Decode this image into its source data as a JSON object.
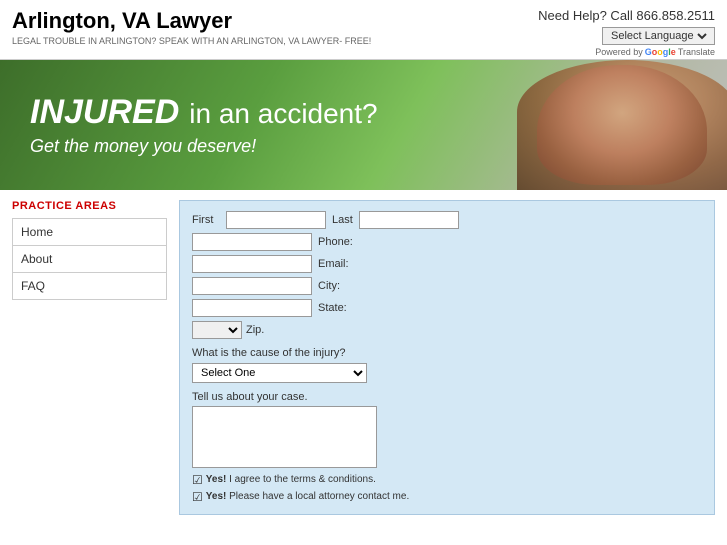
{
  "header": {
    "title": "Arlington, VA Lawyer",
    "subtitle": "LEGAL TROUBLE IN ARLINGTON? SPEAK WITH AN ARLINGTON, VA LAWYER- FREE!",
    "need_help": "Need Help? Call 866.858.2511",
    "translate_label": "Select Language",
    "powered_by": "Powered by",
    "translate_text": "Translate"
  },
  "banner": {
    "injured": "INJURED",
    "rest": "in an accident?",
    "subtitle": "Get the money you deserve!"
  },
  "sidebar": {
    "practice_areas_label": "PRACTICE AREAS",
    "items": [
      {
        "label": "Home"
      },
      {
        "label": "About"
      },
      {
        "label": "FAQ"
      }
    ]
  },
  "form": {
    "first_label": "First",
    "last_label": "Last",
    "phone_label": "Phone:",
    "email_label": "Email:",
    "city_label": "City:",
    "state_label": "State:",
    "zip_label": "Zip.",
    "cause_question": "What is the cause of the injury?",
    "cause_placeholder": "Select One",
    "tell_label": "Tell us about your case.",
    "checkbox1_yes": "Yes!",
    "checkbox1_text": " I agree to the terms & conditions.",
    "checkbox2_yes": "Yes!",
    "checkbox2_text": " Please have a local attorney contact me."
  }
}
